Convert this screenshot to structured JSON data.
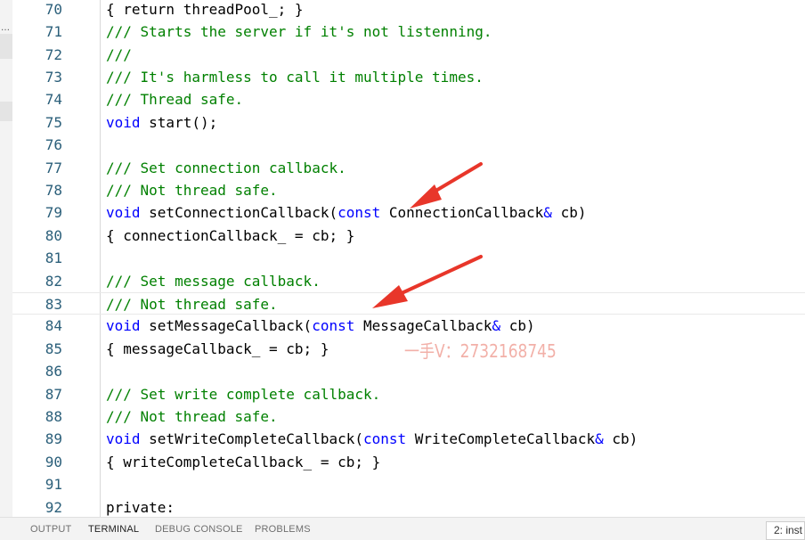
{
  "editor": {
    "lines": [
      {
        "num": "70",
        "code": "{ return threadPool_; }"
      },
      {
        "num": "71",
        "code": "/// Starts the server if it's not listenning."
      },
      {
        "num": "72",
        "code": "///"
      },
      {
        "num": "73",
        "code": "/// It's harmless to call it multiple times."
      },
      {
        "num": "74",
        "code": "/// Thread safe."
      },
      {
        "num": "75",
        "code": "void start();"
      },
      {
        "num": "76",
        "code": ""
      },
      {
        "num": "77",
        "code": "/// Set connection callback."
      },
      {
        "num": "78",
        "code": "/// Not thread safe."
      },
      {
        "num": "79",
        "code": "void setConnectionCallback(const ConnectionCallback& cb)"
      },
      {
        "num": "80",
        "code": "{ connectionCallback_ = cb; }"
      },
      {
        "num": "81",
        "code": ""
      },
      {
        "num": "82",
        "code": "/// Set message callback."
      },
      {
        "num": "83",
        "code": "/// Not thread safe."
      },
      {
        "num": "84",
        "code": "void setMessageCallback(const MessageCallback& cb)"
      },
      {
        "num": "85",
        "code": "{ messageCallback_ = cb; }"
      },
      {
        "num": "86",
        "code": ""
      },
      {
        "num": "87",
        "code": "/// Set write complete callback."
      },
      {
        "num": "88",
        "code": "/// Not thread safe."
      },
      {
        "num": "89",
        "code": "void setWriteCompleteCallback(const WriteCompleteCallback& cb)"
      },
      {
        "num": "90",
        "code": "{ writeCompleteCallback_ = cb; }"
      },
      {
        "num": "91",
        "code": ""
      },
      {
        "num": "92",
        "code": "private:"
      }
    ]
  },
  "watermark": "一手V：2732168745",
  "panel": {
    "tabs": [
      "OUTPUT",
      "TERMINAL",
      "DEBUG CONSOLE",
      "PROBLEMS"
    ],
    "active_tab": "TERMINAL",
    "terminal_select": "2: inst"
  },
  "colors": {
    "comment": "#008000",
    "keyword": "#0000ff",
    "line_number": "#2b5f7a",
    "arrow": "#e8362a"
  }
}
